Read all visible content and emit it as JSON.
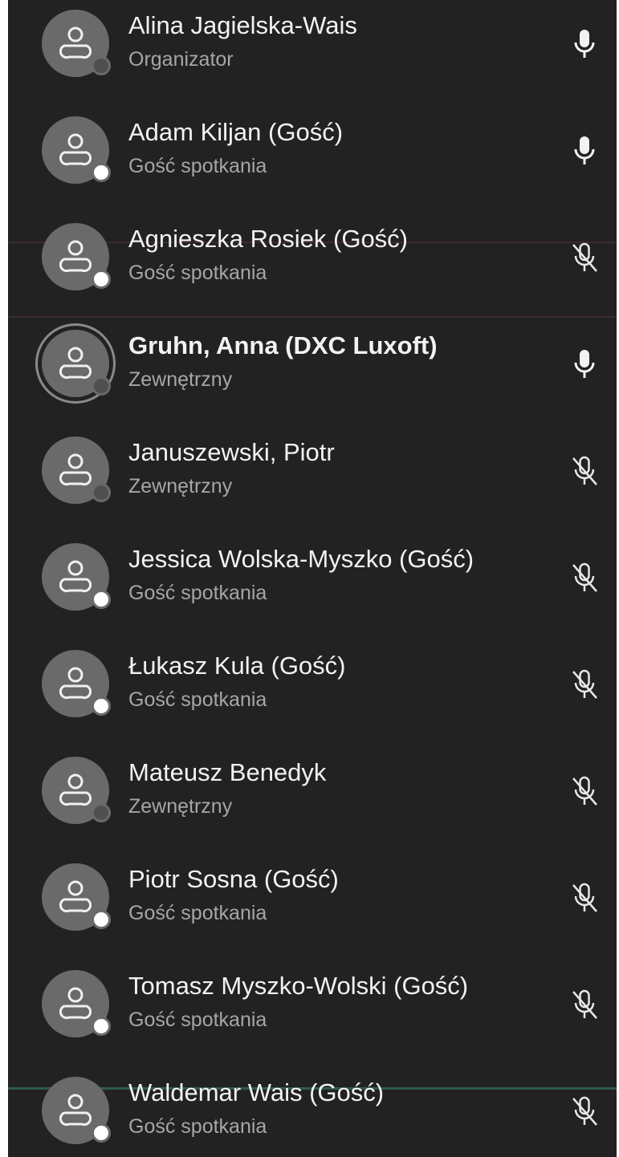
{
  "participants": [
    {
      "name": "Alina Jagielska-Wais",
      "role": "Organizator",
      "mic": "mic-on",
      "presence": "away",
      "active": false
    },
    {
      "name": "Adam Kiljan (Gość)",
      "role": "Gość spotkania",
      "mic": "mic-on",
      "presence": "available",
      "active": false
    },
    {
      "name": "Agnieszka Rosiek (Gość)",
      "role": "Gość spotkania",
      "mic": "mic-off",
      "presence": "available",
      "active": false
    },
    {
      "name": "Gruhn, Anna (DXC Luxoft)",
      "role": "Zewnętrzny",
      "mic": "mic-on",
      "presence": "away",
      "active": true
    },
    {
      "name": "Januszewski, Piotr",
      "role": "Zewnętrzny",
      "mic": "mic-off",
      "presence": "away",
      "active": false
    },
    {
      "name": "Jessica Wolska-Myszko (Gość)",
      "role": "Gość spotkania",
      "mic": "mic-off",
      "presence": "available",
      "active": false
    },
    {
      "name": "Łukasz Kula (Gość)",
      "role": "Gość spotkania",
      "mic": "mic-off",
      "presence": "available",
      "active": false
    },
    {
      "name": "Mateusz Benedyk",
      "role": "Zewnętrzny",
      "mic": "mic-off",
      "presence": "away",
      "active": false
    },
    {
      "name": "Piotr Sosna (Gość)",
      "role": "Gość spotkania",
      "mic": "mic-off",
      "presence": "available",
      "active": false
    },
    {
      "name": "Tomasz Myszko-Wolski (Gość)",
      "role": "Gość spotkania",
      "mic": "mic-off",
      "presence": "available",
      "active": false
    },
    {
      "name": "Waldemar Wais (Gość)",
      "role": "Gość spotkania",
      "mic": "mic-off",
      "presence": "available",
      "active": false
    }
  ],
  "colors": {
    "panel_background": "#222223",
    "avatar": "#6a6a6b",
    "name_text": "#f2f2f2",
    "role_text": "#a6a6a7",
    "presence_available": "#ffffff",
    "presence_away": "#4f4f50",
    "scan_line_red": "#5a3a36",
    "scan_line_green": "#2f5a52"
  }
}
